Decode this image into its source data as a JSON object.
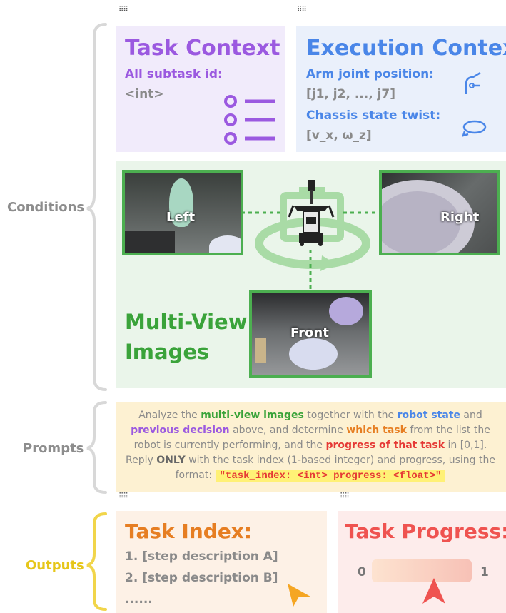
{
  "sections": {
    "conditions": "Conditions",
    "prompts": "Prompts",
    "outputs": "Outputs"
  },
  "task_context": {
    "title": "Task Context",
    "subtitle": "All subtask id:",
    "value": "<int>"
  },
  "execution_context": {
    "title": "Execution Context",
    "arm_label": "Arm joint position:",
    "arm_value": "[j1, j2, ..., j7]",
    "chassis_label": "Chassis state twist:",
    "chassis_value": "[v_x, ω_z]"
  },
  "multiview": {
    "title_line1": "Multi-View",
    "title_line2": "Images",
    "left": "Left",
    "right": "Right",
    "front": "Front"
  },
  "prompt": {
    "p1": "Analyze the ",
    "h1": "multi-view images",
    "p2": " together with the ",
    "h2": "robot state",
    "p3": " and ",
    "h3": "previous decision",
    "p4": " above, and determine ",
    "h4": "which task",
    "p5": " from the list the robot is currently performing, and the ",
    "h5": "progress of that task",
    "p6": " in [0,1]. Reply ",
    "h6": "ONLY",
    "p7": " with the task index (1-based integer) and progress, using the format: ",
    "format": "\"task_index: <int> progress: <float>\""
  },
  "task_index": {
    "title": "Task Index:",
    "item1": "1. [step description A]",
    "item2": "2. [step description B]",
    "item3": "......"
  },
  "task_progress": {
    "title": "Task Progress:",
    "min": "0",
    "max": "1",
    "progress_value": 0.62
  },
  "colors": {
    "purple": "#9b59e0",
    "blue": "#4a86e8",
    "green": "#3aa33a",
    "orange": "#e67e22",
    "red": "#ef5350",
    "yellow": "#e6c619"
  }
}
